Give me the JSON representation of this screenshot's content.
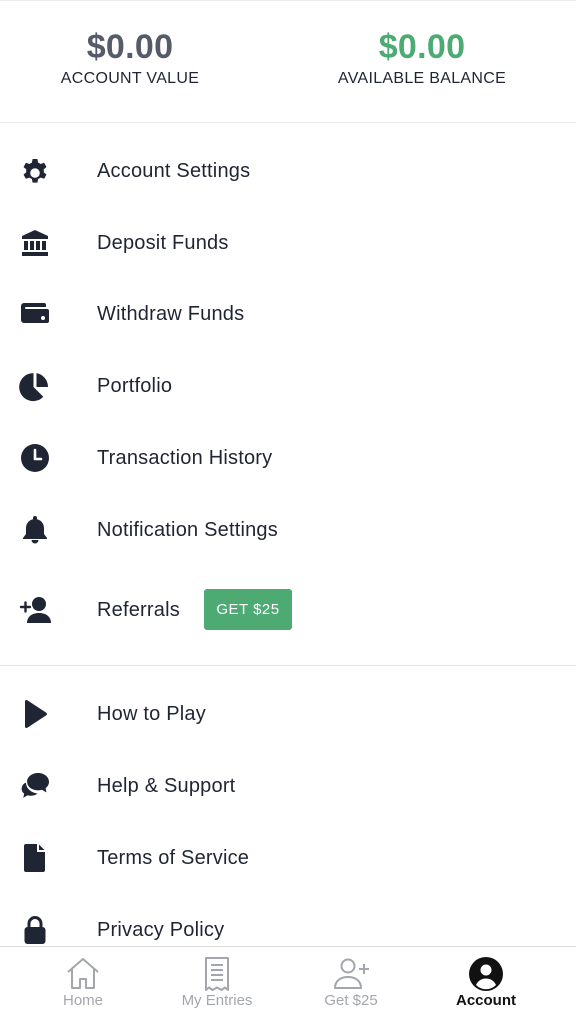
{
  "balances": {
    "account_value": {
      "amount": "$0.00",
      "label": "ACCOUNT VALUE"
    },
    "available_balance": {
      "amount": "$0.00",
      "label": "AVAILABLE BALANCE"
    }
  },
  "colors": {
    "accent_green": "#4caa72",
    "text_dark": "#1f2533",
    "muted_gray": "#a3a6ad"
  },
  "menu_primary": [
    {
      "label": "Account Settings",
      "icon": "gear-icon"
    },
    {
      "label": "Deposit Funds",
      "icon": "bank-icon"
    },
    {
      "label": "Withdraw Funds",
      "icon": "wallet-icon"
    },
    {
      "label": "Portfolio",
      "icon": "pie-chart-icon"
    },
    {
      "label": "Transaction History",
      "icon": "clock-icon"
    },
    {
      "label": "Notification Settings",
      "icon": "bell-icon"
    },
    {
      "label": "Referrals",
      "icon": "user-plus-icon",
      "badge": "GET $25"
    }
  ],
  "menu_secondary": [
    {
      "label": "How to Play",
      "icon": "play-icon"
    },
    {
      "label": "Help & Support",
      "icon": "chat-bubbles-icon"
    },
    {
      "label": "Terms of Service",
      "icon": "document-icon"
    },
    {
      "label": "Privacy Policy",
      "icon": "lock-icon"
    }
  ],
  "bottom_nav": [
    {
      "label": "Home",
      "icon": "home-icon",
      "active": false
    },
    {
      "label": "My Entries",
      "icon": "receipt-icon",
      "active": false
    },
    {
      "label": "Get $25",
      "icon": "user-plus-icon",
      "active": false
    },
    {
      "label": "Account",
      "icon": "account-circle-icon",
      "active": true
    }
  ]
}
